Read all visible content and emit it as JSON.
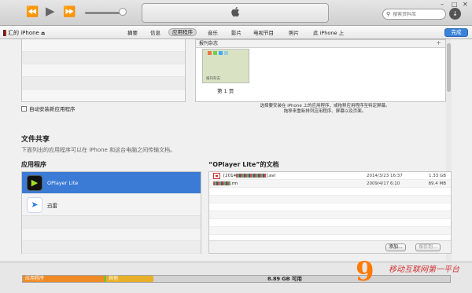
{
  "toolbar": {
    "prev_icon": "rewind-icon",
    "play_icon": "play-icon",
    "next_icon": "fast-forward-icon",
    "volume_level": 0.9,
    "logo_glyph": "",
    "search_placeholder": "搜索资料库",
    "window_buttons": [
      "–",
      "□",
      "✕"
    ]
  },
  "nav": {
    "device_name": "汇的 iPhone",
    "tabs": [
      "摘要",
      "信息",
      "应用程序",
      "音乐",
      "影片",
      "电视节目",
      "照片",
      "此 iPhone 上"
    ],
    "active_tab": "应用程序",
    "done_label": "完成"
  },
  "screens": {
    "header_label": "报刊杂志",
    "thumb_caption": "报刊杂志",
    "page_label": "第 1 页",
    "hint_line1": "选择要安装在 iPhone 上的应用程序，或拖移应用程序至特定屏幕。",
    "hint_line2": "拖移来重新排列应用程序、屏幕以及页面。"
  },
  "auto_install_label": "自动安装新应用程序",
  "file_sharing": {
    "title": "文件共享",
    "description": "下面列出的应用程序可以在 iPhone 和这台电脑之间传输文档。",
    "apps_title": "应用程序",
    "docs_title": "“OPlayer Lite”的文档",
    "apps": [
      {
        "name": "OPlayer Lite",
        "icon": "oplayer-icon",
        "selected": true
      },
      {
        "name": "迅雷",
        "icon": "xunlei-bird-icon",
        "selected": false
      }
    ],
    "documents": [
      {
        "name_prefix": "[2014",
        "name_suffix": "].avi",
        "date": "2014/3/23 16:37",
        "size": "1.33 GB"
      },
      {
        "name_prefix": "",
        "name_suffix": ".rm",
        "date": "2009/4/17 6:10",
        "size": "89.4 MB"
      }
    ],
    "add_button": "添加...",
    "save_button": "保存到..."
  },
  "capacity": {
    "segments": [
      {
        "label": "应用程序",
        "color": "#f08a24",
        "fraction": 0.19
      },
      {
        "label": "其他",
        "color": "#e8b02a",
        "fraction": 0.11
      }
    ],
    "apps_gap_color": "#7dbb3a",
    "free_label": "8.89 GB 可用"
  },
  "watermark": {
    "logo": "9",
    "text": "移动互联网第一平台"
  }
}
